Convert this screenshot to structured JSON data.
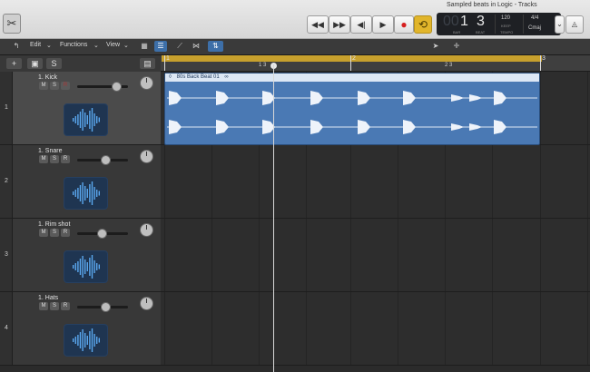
{
  "window_title": "Sampled beats in Logic - Tracks",
  "transport": {
    "rewind": "◀◀",
    "forward": "▶▶",
    "to_start": "◀|",
    "play": "▶",
    "record": "●",
    "cycle": "⟲"
  },
  "lcd": {
    "bar_dim": "00",
    "bar": "1",
    "beat": "3",
    "tempo": "120",
    "tempo_label": "KEEP",
    "sig": "4/4",
    "key": "Cmaj",
    "bar_label": "BAR",
    "beat_label": "BEAT",
    "tempo_sub": "TEMPO"
  },
  "menubar": {
    "edit": "Edit",
    "functions": "Functions",
    "view": "View"
  },
  "ruler": {
    "marks": [
      "1",
      "1 3",
      "2",
      "2 3",
      "3"
    ]
  },
  "tracks": [
    {
      "number": "1",
      "name": "1. Kick",
      "volume": 0.8
    },
    {
      "number": "2",
      "name": "1. Snare",
      "volume": 0.55
    },
    {
      "number": "3",
      "name": "1. Rim shot",
      "volume": 0.47
    },
    {
      "number": "4",
      "name": "1. Hats",
      "volume": 0.55
    }
  ],
  "msr": {
    "mute": "M",
    "solo": "S",
    "record": "R"
  },
  "region": {
    "name": "80s Back Beat 01"
  },
  "colors": {
    "region": "#4a79b4",
    "cycle": "#c7a02d",
    "selected_track": "#4b4b4b"
  }
}
